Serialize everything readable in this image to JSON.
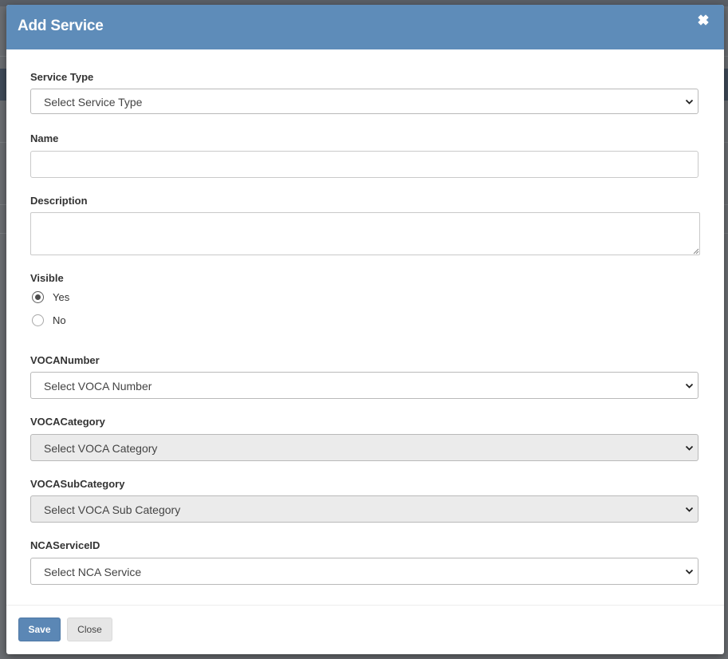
{
  "modal": {
    "title": "Add Service",
    "close_icon": "close-icon"
  },
  "form": {
    "service_type": {
      "label": "Service Type",
      "selected": "Select Service Type"
    },
    "name": {
      "label": "Name",
      "value": ""
    },
    "description": {
      "label": "Description",
      "value": ""
    },
    "visible": {
      "label": "Visible",
      "options": [
        {
          "label": "Yes",
          "checked": true
        },
        {
          "label": "No",
          "checked": false
        }
      ]
    },
    "voca_number": {
      "label": "VOCANumber",
      "selected": "Select VOCA Number"
    },
    "voca_category": {
      "label": "VOCACategory",
      "selected": "Select VOCA Category",
      "disabled": true
    },
    "voca_subcategory": {
      "label": "VOCASubCategory",
      "selected": "Select VOCA Sub Category",
      "disabled": true
    },
    "nca_service_id": {
      "label": "NCAServiceID",
      "selected": "Select NCA Service"
    }
  },
  "footer": {
    "save_label": "Save",
    "close_label": "Close"
  },
  "colors": {
    "header_bg": "#5e8cb9",
    "save_bg": "#5b87b5",
    "disabled_bg": "#ebebeb"
  }
}
